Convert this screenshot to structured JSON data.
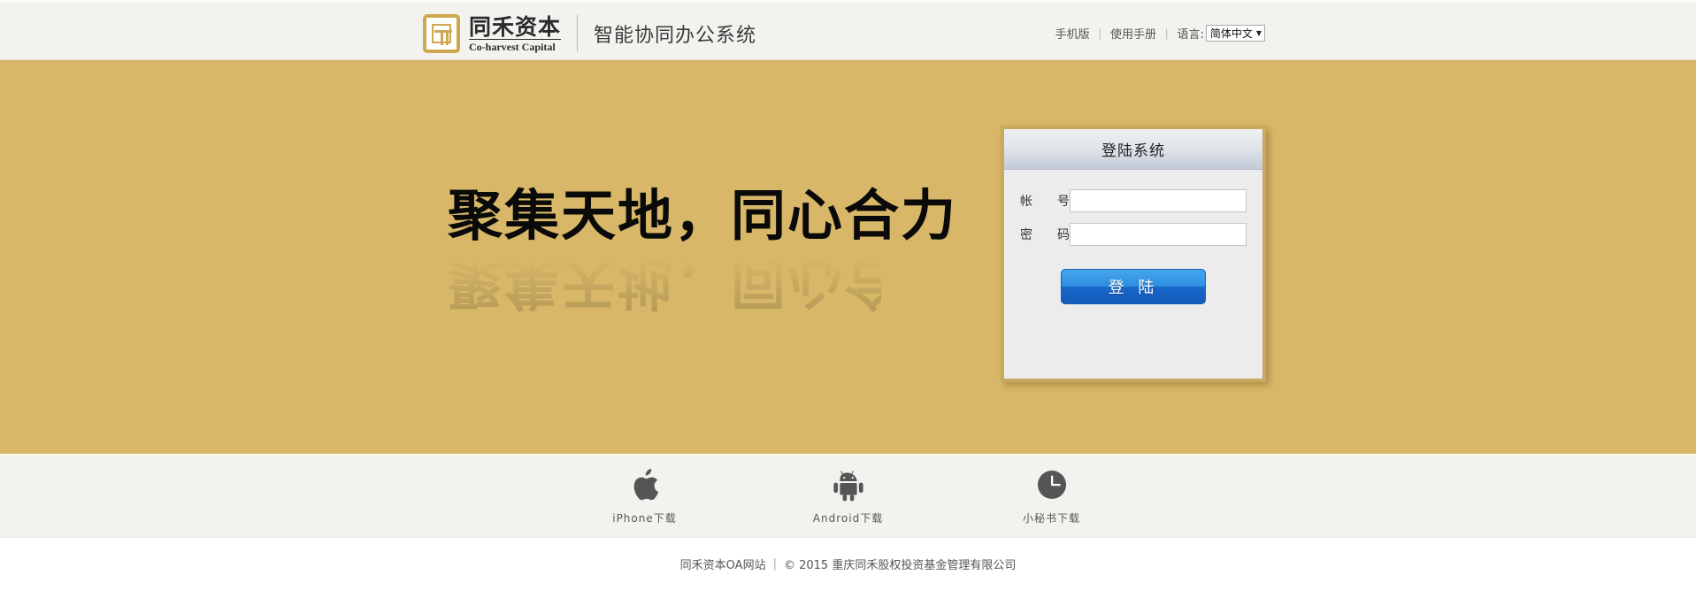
{
  "header": {
    "logo_icon": "cohar-vest-seal-logo",
    "brand_cn": "同禾资本",
    "brand_en": "Co-harvest Capital",
    "subtitle": "智能协同办公系统",
    "nav": {
      "mobile_label": "手机版",
      "manual_label": "使用手册",
      "separator": "|",
      "language_label": "语言:",
      "language_selected": "简体中文",
      "language_caret": "▼"
    }
  },
  "banner": {
    "slogan": "聚集天地，同心合力",
    "background_color": "#d8b868"
  },
  "login": {
    "title": "登陆系统",
    "account_label_char1": "帐",
    "account_label_char2": "号",
    "account_value": "",
    "account_placeholder": "",
    "password_label_char1": "密",
    "password_label_char2": "码",
    "password_value": "",
    "password_placeholder": "",
    "submit_label": "登 陆",
    "submit_color": "#1f7fd8",
    "border_color": "#c9a860"
  },
  "downloads": [
    {
      "icon": "apple-icon",
      "label": "iPhone下载"
    },
    {
      "icon": "android-icon",
      "label": "Android下载"
    },
    {
      "icon": "clock-icon",
      "label": "小秘书下载"
    }
  ],
  "footer": {
    "site_name": "同禾资本OA网站",
    "separator": "|",
    "copyright": "© 2015  重庆同禾股权投资基金管理有限公司"
  }
}
